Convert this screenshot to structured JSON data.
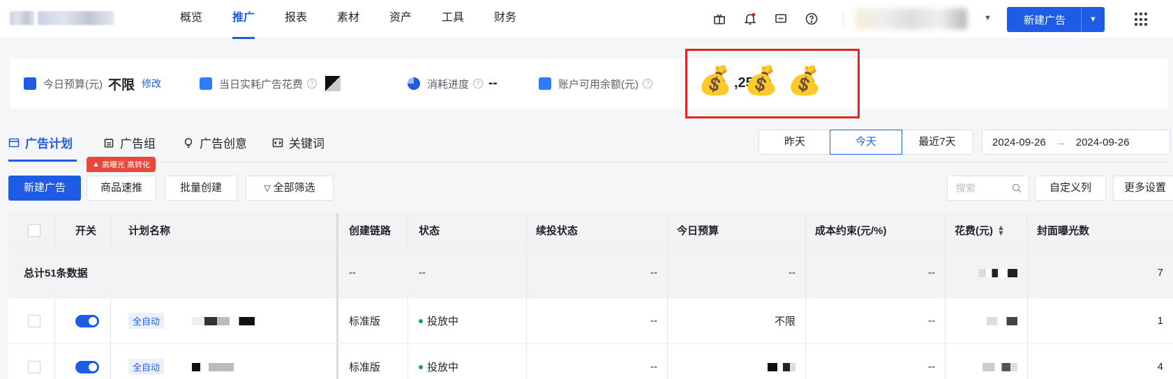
{
  "nav": {
    "items": [
      "概览",
      "推广",
      "报表",
      "素材",
      "资产",
      "工具",
      "财务"
    ],
    "active": "推广",
    "new_ad_button": "新建广告"
  },
  "summary": {
    "today_budget_label": "今日预算(元)",
    "today_budget_value": "不限",
    "today_budget_edit": "修改",
    "spend_label": "当日实耗广告花费",
    "progress_label": "消耗进度",
    "progress_value": "--",
    "balance_label": "账户可用余额(元)",
    "balance_partial": ",25",
    "balance_emoji": "💰"
  },
  "tabs": {
    "items": [
      "广告计划",
      "广告组",
      "广告创意",
      "关键词"
    ],
    "active": "广告计划"
  },
  "date_filter": {
    "options": [
      "昨天",
      "今天",
      "最近7天"
    ],
    "selected": "今天",
    "start": "2024-09-26",
    "end": "2024-09-26",
    "arrow": "→"
  },
  "promo_badge": "高曝光 高转化",
  "actions": {
    "new_ad": "新建广告",
    "quick_promote": "商品速推",
    "batch_create": "批量创建",
    "all_filter": "全部筛选",
    "search_placeholder": "搜索",
    "custom_columns": "自定义列",
    "more_settings": "更多设置"
  },
  "table": {
    "headers": [
      "开关",
      "计划名称",
      "创建链路",
      "状态",
      "续投状态",
      "今日预算",
      "成本约束(元/%)",
      "花费(元)",
      "封面曝光数"
    ],
    "total_label": "总计51条数据",
    "total_values": [
      "--",
      "--",
      "--",
      "--",
      "--",
      "7"
    ],
    "rows": [
      {
        "name_tag": "全自动",
        "link": "标准版",
        "status": "投放中",
        "renew": "--",
        "budget": "不限",
        "cost": "--",
        "last": "1"
      },
      {
        "name_tag": "全自动",
        "link": "标准版",
        "status": "投放中",
        "renew": "--",
        "budget": "",
        "cost": "--",
        "last": "4"
      }
    ]
  }
}
